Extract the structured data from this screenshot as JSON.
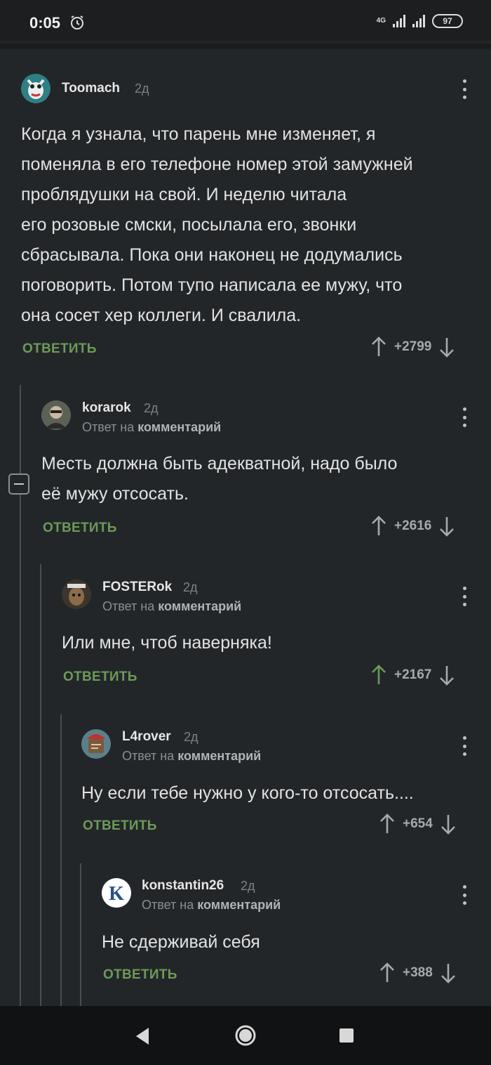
{
  "status_bar": {
    "time": "0:05",
    "network": "4G",
    "battery": "97"
  },
  "comments": [
    {
      "user": "Toomach",
      "time": "2д",
      "text_lines": [
        "Когда я узнала, что парень мне изменяет, я",
        "поменяла в его телефоне номер этой замужней",
        "проблядушки на свой. И неделю читала",
        "его розовые смски, посылала его, звонки",
        "сбрасывала. Пока они наконец не додумались",
        "поговорить. Потом тупо написала ее мужу, что",
        "она сосет хер коллеги. И свалила."
      ],
      "reply_label": "ОТВЕТИТЬ",
      "score": "+2799",
      "upvoted": false
    },
    {
      "user": "korarok",
      "time": "2д",
      "reply_prefix": "Ответ на",
      "reply_target": "комментарий",
      "text_lines": [
        "Месть должна быть адекватной, надо было",
        "её мужу отсосать."
      ],
      "reply_label": "ОТВЕТИТЬ",
      "score": "+2616",
      "upvoted": false
    },
    {
      "user": "FOSTERok",
      "time": "2д",
      "reply_prefix": "Ответ на",
      "reply_target": "комментарий",
      "text_lines": [
        "Или мне, чтоб наверняка!"
      ],
      "reply_label": "ОТВЕТИТЬ",
      "score": "+2167",
      "upvoted": true
    },
    {
      "user": "L4rover",
      "time": "2д",
      "reply_prefix": "Ответ на",
      "reply_target": "комментарий",
      "text_lines": [
        "Ну если тебе нужно у кого-то отсосать...."
      ],
      "reply_label": "ОТВЕТИТЬ",
      "score": "+654",
      "upvoted": false
    },
    {
      "user": "konstantin26",
      "time": "2д",
      "reply_prefix": "Ответ на",
      "reply_target": "комментарий",
      "text_lines": [
        "Не сдерживай себя"
      ],
      "reply_label": "ОТВЕТИТЬ",
      "score": "+388",
      "upvoted": false
    }
  ],
  "colors": {
    "background": "#232629",
    "reply_green": "#6b9b58",
    "upvote_active": "#6b9b58",
    "arrow_default": "#a6a9ae"
  }
}
